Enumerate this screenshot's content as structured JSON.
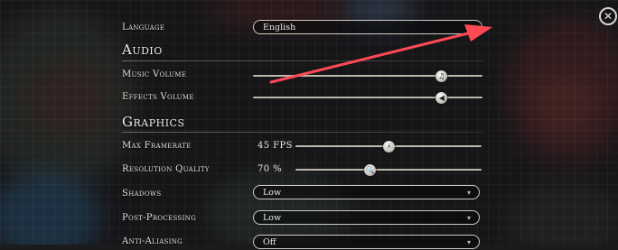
{
  "language": {
    "label": "Language",
    "value": "English"
  },
  "audio": {
    "title": "Audio",
    "music_volume": {
      "label": "Music Volume",
      "level": 0.82,
      "icon": "music-note-icon"
    },
    "effects_volume": {
      "label": "Effects Volume",
      "level": 0.82,
      "icon": "speaker-icon"
    }
  },
  "graphics": {
    "title": "Graphics",
    "max_framerate": {
      "label": "Max Framerate",
      "value": "45 FPS",
      "level": 0.5
    },
    "resolution_quality": {
      "label": "Resolution Quality",
      "value": "70 %",
      "level": 0.4
    },
    "shadows": {
      "label": "Shadows",
      "value": "Low"
    },
    "post_processing": {
      "label": "Post-Processing",
      "value": "Low"
    },
    "anti_aliasing": {
      "label": "Anti-Aliasing",
      "value": "Off"
    }
  },
  "close_button": {
    "glyph": "✕"
  },
  "annotation": {
    "color": "#ff4a55"
  }
}
